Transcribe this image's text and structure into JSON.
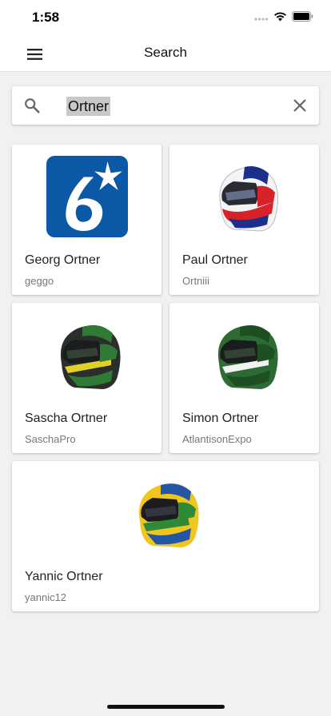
{
  "status_bar": {
    "time": "1:58"
  },
  "app_bar": {
    "title": "Search"
  },
  "search": {
    "value": "Ortner"
  },
  "results": [
    {
      "name": "Georg Ortner",
      "username": "geggo",
      "avatar": "logo-six-star"
    },
    {
      "name": "Paul Ortner",
      "username": "Ortniii",
      "avatar": "helmet-white-red-blue"
    },
    {
      "name": "Sascha Ortner",
      "username": "SaschaPro",
      "avatar": "helmet-black-green-yellow"
    },
    {
      "name": "Simon Ortner",
      "username": "AtlantisonExpo",
      "avatar": "helmet-green-white"
    },
    {
      "name": "Yannic Ortner",
      "username": "yannic12",
      "avatar": "helmet-yellow-green-blue"
    }
  ],
  "colors": {
    "logo_blue": "#0b59a6",
    "background": "#f1f1f1"
  }
}
